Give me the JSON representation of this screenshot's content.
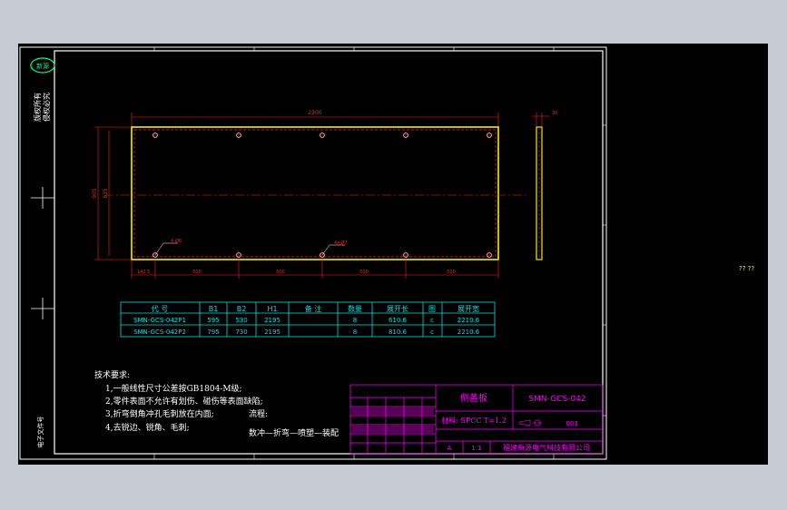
{
  "window": {
    "background": "#c6ccd2",
    "canvas_background": "#000000"
  },
  "side_label": "?? ??",
  "dims": {
    "overall_width": "2300",
    "side_thickness": "30",
    "height_outer": "905",
    "height_inner": "835",
    "bottom_segments": [
      "142.5",
      "500",
      "500",
      "500",
      "500"
    ],
    "hole_note": "4-Ø6",
    "hole_note2": "4×Ø7"
  },
  "parts_table": {
    "headers": [
      "代 号",
      "B1",
      "B2",
      "H1",
      "备 注",
      "数量",
      "展开长",
      "图",
      "展开宽"
    ],
    "rows": [
      [
        "SMN-GCS-042P1",
        "595",
        "530",
        "2195",
        "",
        "8",
        "610.6",
        "c",
        "2210.6"
      ],
      [
        "SMN-GCS-042P2",
        "795",
        "730",
        "2195",
        "",
        "8",
        "810.6",
        "c",
        "2210.6"
      ]
    ]
  },
  "tech_notes": {
    "title": "技术要求:",
    "lines": [
      "1,一般线性尺寸公差按GB1804-M级;",
      "2,零件表面不允许有划伤、碰伤等表面缺陷;",
      "3,折弯倒角冲孔毛刺放在内面;",
      "4,去锐边、锐角、毛刺;"
    ],
    "process_label": "流程:",
    "process": "数冲—折弯—喷塑—装配"
  },
  "title_block": {
    "part_name": "侧盖板",
    "drawing_no": "SMN-GCS-042",
    "material": "材料: SPCC T=1.2",
    "scale": "1:1",
    "version": "A",
    "sheet": "1",
    "qty": "003",
    "company": "福建新源电气科技有限公司"
  },
  "stamps": {
    "top_left": "新源",
    "left_vertical_1": "版权所有",
    "left_vertical_2": "侵权必究",
    "bottom_left": "电子文件号"
  },
  "colors": {
    "border": "#ffffff",
    "dimension": "#ff2020",
    "outline": "#f0f000",
    "table": "#00e0e0",
    "notes": "#ffffff",
    "title_block": "#ff00ff",
    "accent_green": "#00ff80"
  }
}
